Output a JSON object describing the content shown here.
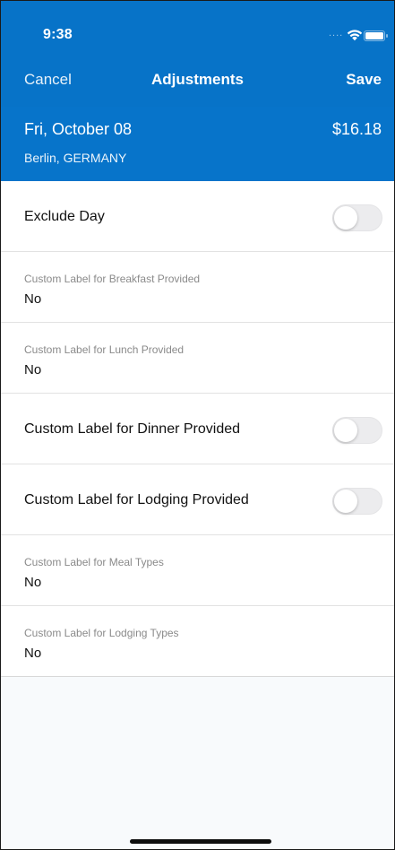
{
  "status_bar": {
    "time": "9:38",
    "signal_dots": "....",
    "wifi_icon": "wifi-icon",
    "battery_icon": "battery-icon"
  },
  "nav": {
    "cancel_label": "Cancel",
    "title": "Adjustments",
    "save_label": "Save"
  },
  "summary": {
    "date": "Fri, October 08",
    "location": "Berlin, GERMANY",
    "amount": "$16.18"
  },
  "rows": [
    {
      "type": "toggle",
      "label": "Exclude Day",
      "on": false
    },
    {
      "type": "value",
      "caption": "Custom Label for Breakfast Provided",
      "value": "No"
    },
    {
      "type": "value",
      "caption": "Custom Label for Lunch Provided",
      "value": "No"
    },
    {
      "type": "toggle",
      "label": "Custom Label for Dinner Provided",
      "on": false
    },
    {
      "type": "toggle",
      "label": "Custom Label for Lodging Provided",
      "on": false
    },
    {
      "type": "value",
      "caption": "Custom Label for Meal Types",
      "value": "No"
    },
    {
      "type": "value",
      "caption": "Custom Label for Lodging Types",
      "value": "No"
    }
  ],
  "colors": {
    "header_blue": "#0773c8",
    "toggle_off": "#ececee",
    "caption_gray": "#8a8a8a"
  }
}
